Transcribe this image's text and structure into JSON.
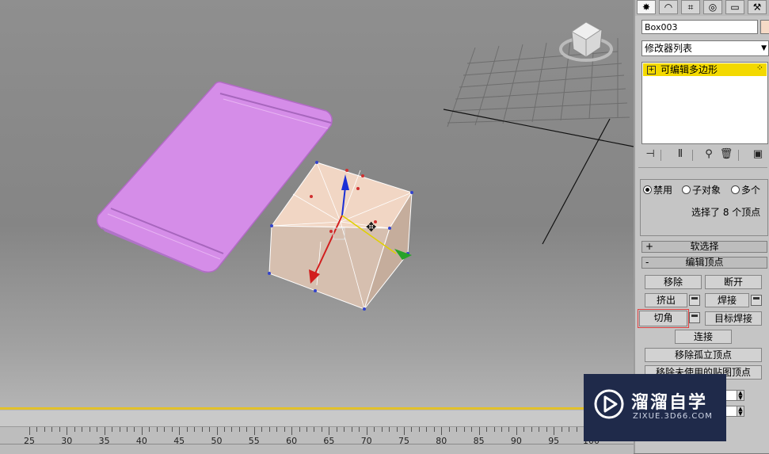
{
  "viewport": {
    "ruler_labels": [
      "25",
      "30",
      "35",
      "40",
      "45",
      "50",
      "55",
      "60",
      "65",
      "70",
      "75",
      "80",
      "85",
      "90",
      "95",
      "100"
    ]
  },
  "panel": {
    "tab_icons": [
      "create-icon",
      "modify-icon",
      "hierarchy-icon",
      "motion-icon",
      "display-icon",
      "utilities-icon"
    ],
    "object_name": "Box003",
    "object_color": "#f6dac6",
    "modifier_list": "修改器列表",
    "stack_item": "可编辑多边形",
    "stack_color": "#f3d900",
    "selection": {
      "options": [
        "禁用",
        "子对象",
        "多个"
      ],
      "selected": "禁用",
      "status": "选择了 8 个顶点"
    },
    "soft_selection": "软选择",
    "edit_vertices": {
      "title": "编辑顶点",
      "remove": "移除",
      "break": "断开",
      "extrude": "挤出",
      "weld": "焊接",
      "chamfer": "切角",
      "target_weld": "目标焊接",
      "connect": "连接",
      "remove_isolated": "移除孤立顶点",
      "remove_unused_map": "移除未使用的贴图顶点"
    }
  },
  "watermark": {
    "title": "溜溜自学",
    "url": "ZIXUE.3D66.COM"
  }
}
